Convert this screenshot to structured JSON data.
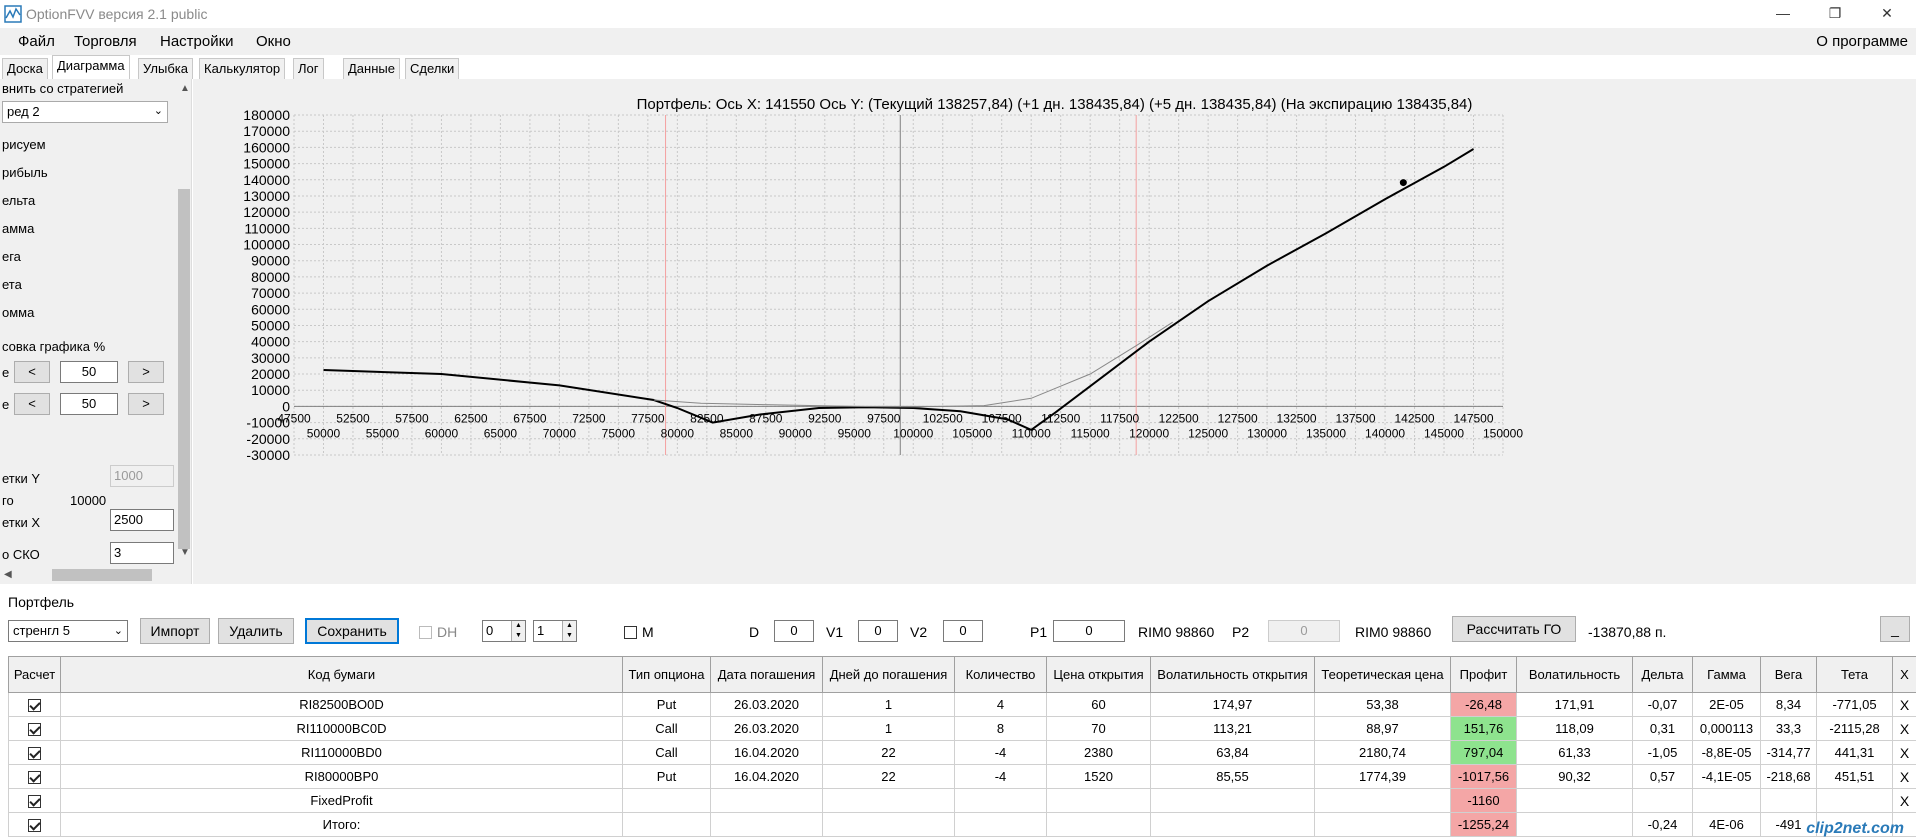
{
  "window": {
    "title": "OptionFVV версия 2.1 public",
    "minimize": "—",
    "maximize": "❐",
    "close": "✕"
  },
  "menu": {
    "items": [
      "Файл",
      "Торговля",
      "Настройки",
      "Окно"
    ],
    "about": "О программе"
  },
  "tabs": [
    "Доска",
    "Диаграмма",
    "Улыбка",
    "Калькулятор",
    "Лог",
    "Данные",
    "Сделки"
  ],
  "left_panel": {
    "compare_label": "внить со стратегией",
    "compare_value": "ред 2",
    "draw_label": "рисуем",
    "draw_items": [
      "рибыль",
      "ельта",
      "амма",
      "ега",
      "ета",
      "омма"
    ],
    "scale_label": "совка графика %",
    "row1_prefix": "е",
    "row2_prefix": "е",
    "dec": "<",
    "inc": ">",
    "scale1": "50",
    "scale2": "50",
    "gridY_label": "етки Y",
    "gridY_value": "1000",
    "step_label": "го",
    "step_value": "10000",
    "gridX_label": "етки X",
    "gridX_value": "2500",
    "sko_label": "о СКО",
    "sko_value": "3"
  },
  "chart_header": "Портфель: Ось X: 141550 Ось Y:  (Текущий 138257,84)  (+1 дн. 138435,84)  (+5 дн. 138435,84)  (На экспирацию 138435,84)",
  "chart_data": {
    "type": "line",
    "ylim": [
      -30000,
      180000
    ],
    "xlim": [
      47500,
      150000
    ],
    "y_ticks": [
      180000,
      170000,
      160000,
      150000,
      140000,
      130000,
      120000,
      110000,
      100000,
      90000,
      80000,
      70000,
      60000,
      50000,
      40000,
      30000,
      20000,
      10000,
      0,
      -10000,
      -20000,
      -30000
    ],
    "x_ticks_upper": [
      47500,
      52500,
      57500,
      62500,
      67500,
      72500,
      77500,
      82500,
      87500,
      92500,
      97500,
      102500,
      107500,
      112500,
      117500,
      122500,
      127500,
      132500,
      137500,
      142500,
      147500
    ],
    "x_ticks_lower": [
      50000,
      55000,
      60000,
      65000,
      70000,
      75000,
      80000,
      85000,
      90000,
      95000,
      100000,
      105000,
      110000,
      115000,
      120000,
      125000,
      130000,
      135000,
      140000,
      145000,
      150000
    ],
    "vlines_red": [
      79000,
      118900
    ],
    "vline_current": 98900,
    "marker": {
      "x": 141550,
      "y": 138257.84
    },
    "series": [
      {
        "values": [
          [
            50000,
            22500
          ],
          [
            60000,
            20000
          ],
          [
            70000,
            13000
          ],
          [
            78000,
            4000
          ],
          [
            80000,
            -1000
          ],
          [
            83000,
            -10000
          ],
          [
            87000,
            -5000
          ],
          [
            92000,
            -1000
          ],
          [
            96000,
            -500
          ],
          [
            100000,
            -1000
          ],
          [
            104000,
            -3000
          ],
          [
            108000,
            -8000
          ],
          [
            110000,
            -14500
          ],
          [
            112000,
            -4000
          ],
          [
            116000,
            18000
          ],
          [
            120000,
            40000
          ],
          [
            125000,
            65000
          ],
          [
            130000,
            87000
          ],
          [
            135000,
            107000
          ],
          [
            140000,
            128000
          ],
          [
            145000,
            148000
          ],
          [
            147500,
            159000
          ]
        ]
      },
      {
        "values": [
          [
            78000,
            4000
          ],
          [
            82000,
            2000
          ],
          [
            88000,
            1000
          ],
          [
            95000,
            0
          ],
          [
            100000,
            -300
          ],
          [
            106000,
            500
          ],
          [
            110000,
            5000
          ],
          [
            115000,
            20000
          ],
          [
            119000,
            38000
          ],
          [
            122000,
            52000
          ]
        ]
      }
    ],
    "grid": true
  },
  "portfolio": {
    "label": "Портфель",
    "strategy": "стренгл 5",
    "btn_import": "Импорт",
    "btn_delete": "Удалить",
    "btn_save": "Сохранить",
    "dh_label": "DH",
    "spin1": "0",
    "spin2": "1",
    "m_label": "M",
    "d_label": "D",
    "d_value": "0",
    "v1_label": "V1",
    "v1_value": "0",
    "v2_label": "V2",
    "v2_value": "0",
    "p1_label": "P1",
    "p1_value": "0",
    "p1_ticker": "RIM0 98860",
    "p2_label": "P2",
    "p2_value": "0",
    "p2_ticker": "RIM0 98860",
    "btn_go": "Рассчитать ГО",
    "go_value": "-13870,88 п.",
    "btn_min": "_"
  },
  "table": {
    "headers": [
      "Расчет",
      "Код бумаги",
      "Тип опциона",
      "Дата погашения",
      "Дней до погашения",
      "Количество",
      "Цена открытия",
      "Волатильность открытия",
      "Теоретическая цена",
      "Профит",
      "Волатильность",
      "Дельта",
      "Гамма",
      "Вега",
      "Тета",
      "X"
    ],
    "rows": [
      {
        "code": "RI82500BO0D",
        "type": "Put",
        "date": "26.03.2020",
        "days": "1",
        "qty": "4",
        "price": "60",
        "vol_open": "174,97",
        "theo": "53,38",
        "profit": "-26,48",
        "profit_state": "neg",
        "vol": "171,91",
        "delta": "-0,07",
        "gamma": "2E-05",
        "vega": "8,34",
        "theta": "-771,05",
        "x": "X"
      },
      {
        "code": "RI110000BC0D",
        "type": "Call",
        "date": "26.03.2020",
        "days": "1",
        "qty": "8",
        "price": "70",
        "vol_open": "113,21",
        "theo": "88,97",
        "profit": "151,76",
        "profit_state": "pos",
        "vol": "118,09",
        "delta": "0,31",
        "gamma": "0,000113",
        "vega": "33,3",
        "theta": "-2115,28",
        "x": "X"
      },
      {
        "code": "RI110000BD0",
        "type": "Call",
        "date": "16.04.2020",
        "days": "22",
        "qty": "-4",
        "price": "2380",
        "vol_open": "63,84",
        "theo": "2180,74",
        "profit": "797,04",
        "profit_state": "pos",
        "vol": "61,33",
        "delta": "-1,05",
        "gamma": "-8,8E-05",
        "vega": "-314,77",
        "theta": "441,31",
        "x": "X"
      },
      {
        "code": "RI80000BP0",
        "type": "Put",
        "date": "16.04.2020",
        "days": "22",
        "qty": "-4",
        "price": "1520",
        "vol_open": "85,55",
        "theo": "1774,39",
        "profit": "-1017,56",
        "profit_state": "neg",
        "vol": "90,32",
        "delta": "0,57",
        "gamma": "-4,1E-05",
        "vega": "-218,68",
        "theta": "451,51",
        "x": "X"
      },
      {
        "code": "FixedProfit",
        "type": "",
        "date": "",
        "days": "",
        "qty": "",
        "price": "",
        "vol_open": "",
        "theo": "",
        "profit": "-1160",
        "profit_state": "neg",
        "vol": "",
        "delta": "",
        "gamma": "",
        "vega": "",
        "theta": "",
        "x": "X"
      },
      {
        "code": "Итого:",
        "type": "",
        "date": "",
        "days": "",
        "qty": "",
        "price": "",
        "vol_open": "",
        "theo": "",
        "profit": "-1255,24",
        "profit_state": "neg",
        "vol": "",
        "delta": "-0,24",
        "gamma": "4E-06",
        "vega": "-491",
        "theta": "",
        "x": ""
      }
    ]
  },
  "watermark": "clip2net.com"
}
